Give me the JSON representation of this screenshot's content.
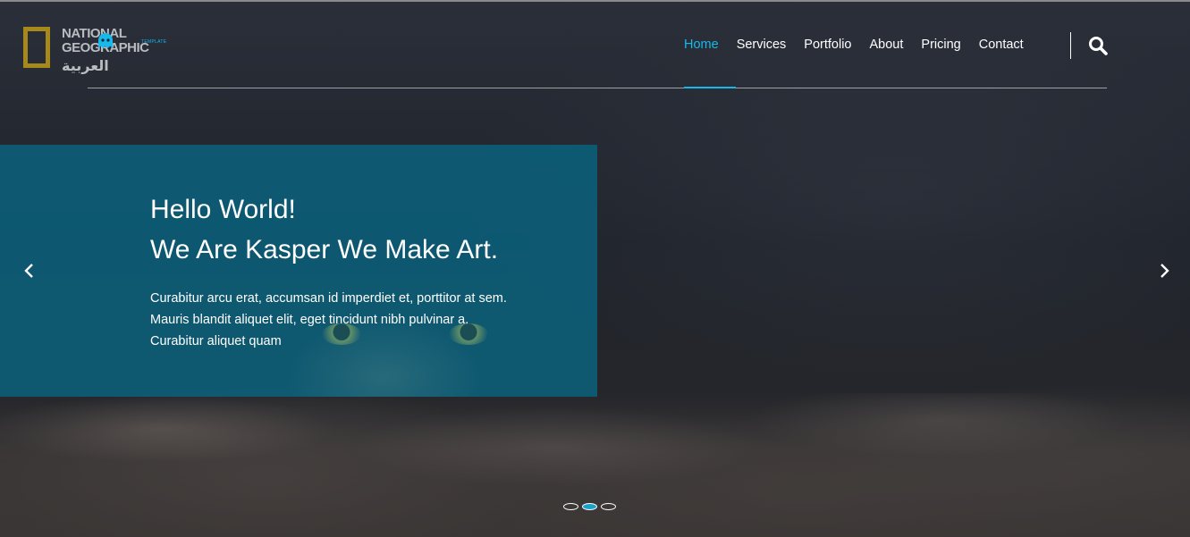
{
  "logo": {
    "line1": "NATIONAL",
    "line2": "GEOGRAPHIC",
    "arabic": "العربية",
    "template_tag": "TEMPLATE",
    "brand_color": "#a6891a"
  },
  "nav": {
    "items": [
      {
        "label": "Home",
        "active": true
      },
      {
        "label": "Services",
        "active": false
      },
      {
        "label": "Portfolio",
        "active": false
      },
      {
        "label": "About",
        "active": false
      },
      {
        "label": "Pricing",
        "active": false
      },
      {
        "label": "Contact",
        "active": false
      }
    ],
    "accent_color": "#19b8ea",
    "search_icon": "search-icon"
  },
  "hero": {
    "line1": "Hello World!",
    "line2": "We Are Kasper We Make Art.",
    "body_line1": "Curabitur arcu erat, accumsan id imperdiet et, porttitor at sem.",
    "body_line2": "Mauris blandit aliquet elit, eget tincidunt nibh pulvinar a.",
    "body_line3": "Curabitur aliquet quam",
    "panel_color": "#0a6480"
  },
  "carousel": {
    "prev_icon": "chevron-left-icon",
    "next_icon": "chevron-right-icon",
    "slide_count": 3,
    "active_slide": 2
  }
}
